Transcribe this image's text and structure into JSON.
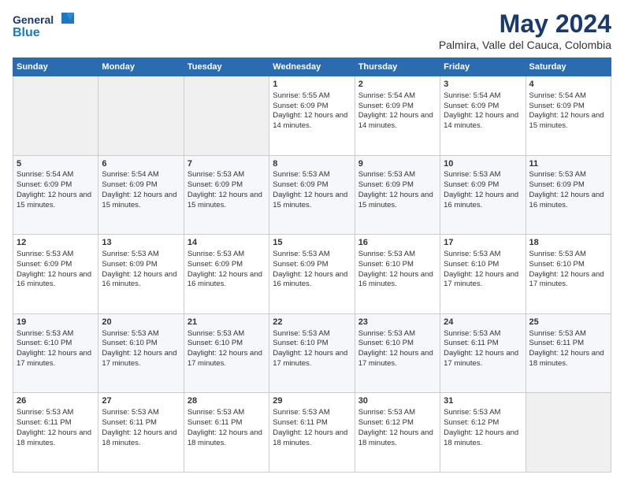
{
  "logo": {
    "general": "General",
    "blue": "Blue"
  },
  "header": {
    "month_year": "May 2024",
    "location": "Palmira, Valle del Cauca, Colombia"
  },
  "weekdays": [
    "Sunday",
    "Monday",
    "Tuesday",
    "Wednesday",
    "Thursday",
    "Friday",
    "Saturday"
  ],
  "weeks": [
    [
      {
        "day": "",
        "sunrise": "",
        "sunset": "",
        "daylight": ""
      },
      {
        "day": "",
        "sunrise": "",
        "sunset": "",
        "daylight": ""
      },
      {
        "day": "",
        "sunrise": "",
        "sunset": "",
        "daylight": ""
      },
      {
        "day": "1",
        "sunrise": "Sunrise: 5:55 AM",
        "sunset": "Sunset: 6:09 PM",
        "daylight": "Daylight: 12 hours and 14 minutes."
      },
      {
        "day": "2",
        "sunrise": "Sunrise: 5:54 AM",
        "sunset": "Sunset: 6:09 PM",
        "daylight": "Daylight: 12 hours and 14 minutes."
      },
      {
        "day": "3",
        "sunrise": "Sunrise: 5:54 AM",
        "sunset": "Sunset: 6:09 PM",
        "daylight": "Daylight: 12 hours and 14 minutes."
      },
      {
        "day": "4",
        "sunrise": "Sunrise: 5:54 AM",
        "sunset": "Sunset: 6:09 PM",
        "daylight": "Daylight: 12 hours and 15 minutes."
      }
    ],
    [
      {
        "day": "5",
        "sunrise": "Sunrise: 5:54 AM",
        "sunset": "Sunset: 6:09 PM",
        "daylight": "Daylight: 12 hours and 15 minutes."
      },
      {
        "day": "6",
        "sunrise": "Sunrise: 5:54 AM",
        "sunset": "Sunset: 6:09 PM",
        "daylight": "Daylight: 12 hours and 15 minutes."
      },
      {
        "day": "7",
        "sunrise": "Sunrise: 5:53 AM",
        "sunset": "Sunset: 6:09 PM",
        "daylight": "Daylight: 12 hours and 15 minutes."
      },
      {
        "day": "8",
        "sunrise": "Sunrise: 5:53 AM",
        "sunset": "Sunset: 6:09 PM",
        "daylight": "Daylight: 12 hours and 15 minutes."
      },
      {
        "day": "9",
        "sunrise": "Sunrise: 5:53 AM",
        "sunset": "Sunset: 6:09 PM",
        "daylight": "Daylight: 12 hours and 15 minutes."
      },
      {
        "day": "10",
        "sunrise": "Sunrise: 5:53 AM",
        "sunset": "Sunset: 6:09 PM",
        "daylight": "Daylight: 12 hours and 16 minutes."
      },
      {
        "day": "11",
        "sunrise": "Sunrise: 5:53 AM",
        "sunset": "Sunset: 6:09 PM",
        "daylight": "Daylight: 12 hours and 16 minutes."
      }
    ],
    [
      {
        "day": "12",
        "sunrise": "Sunrise: 5:53 AM",
        "sunset": "Sunset: 6:09 PM",
        "daylight": "Daylight: 12 hours and 16 minutes."
      },
      {
        "day": "13",
        "sunrise": "Sunrise: 5:53 AM",
        "sunset": "Sunset: 6:09 PM",
        "daylight": "Daylight: 12 hours and 16 minutes."
      },
      {
        "day": "14",
        "sunrise": "Sunrise: 5:53 AM",
        "sunset": "Sunset: 6:09 PM",
        "daylight": "Daylight: 12 hours and 16 minutes."
      },
      {
        "day": "15",
        "sunrise": "Sunrise: 5:53 AM",
        "sunset": "Sunset: 6:09 PM",
        "daylight": "Daylight: 12 hours and 16 minutes."
      },
      {
        "day": "16",
        "sunrise": "Sunrise: 5:53 AM",
        "sunset": "Sunset: 6:10 PM",
        "daylight": "Daylight: 12 hours and 16 minutes."
      },
      {
        "day": "17",
        "sunrise": "Sunrise: 5:53 AM",
        "sunset": "Sunset: 6:10 PM",
        "daylight": "Daylight: 12 hours and 17 minutes."
      },
      {
        "day": "18",
        "sunrise": "Sunrise: 5:53 AM",
        "sunset": "Sunset: 6:10 PM",
        "daylight": "Daylight: 12 hours and 17 minutes."
      }
    ],
    [
      {
        "day": "19",
        "sunrise": "Sunrise: 5:53 AM",
        "sunset": "Sunset: 6:10 PM",
        "daylight": "Daylight: 12 hours and 17 minutes."
      },
      {
        "day": "20",
        "sunrise": "Sunrise: 5:53 AM",
        "sunset": "Sunset: 6:10 PM",
        "daylight": "Daylight: 12 hours and 17 minutes."
      },
      {
        "day": "21",
        "sunrise": "Sunrise: 5:53 AM",
        "sunset": "Sunset: 6:10 PM",
        "daylight": "Daylight: 12 hours and 17 minutes."
      },
      {
        "day": "22",
        "sunrise": "Sunrise: 5:53 AM",
        "sunset": "Sunset: 6:10 PM",
        "daylight": "Daylight: 12 hours and 17 minutes."
      },
      {
        "day": "23",
        "sunrise": "Sunrise: 5:53 AM",
        "sunset": "Sunset: 6:10 PM",
        "daylight": "Daylight: 12 hours and 17 minutes."
      },
      {
        "day": "24",
        "sunrise": "Sunrise: 5:53 AM",
        "sunset": "Sunset: 6:11 PM",
        "daylight": "Daylight: 12 hours and 17 minutes."
      },
      {
        "day": "25",
        "sunrise": "Sunrise: 5:53 AM",
        "sunset": "Sunset: 6:11 PM",
        "daylight": "Daylight: 12 hours and 18 minutes."
      }
    ],
    [
      {
        "day": "26",
        "sunrise": "Sunrise: 5:53 AM",
        "sunset": "Sunset: 6:11 PM",
        "daylight": "Daylight: 12 hours and 18 minutes."
      },
      {
        "day": "27",
        "sunrise": "Sunrise: 5:53 AM",
        "sunset": "Sunset: 6:11 PM",
        "daylight": "Daylight: 12 hours and 18 minutes."
      },
      {
        "day": "28",
        "sunrise": "Sunrise: 5:53 AM",
        "sunset": "Sunset: 6:11 PM",
        "daylight": "Daylight: 12 hours and 18 minutes."
      },
      {
        "day": "29",
        "sunrise": "Sunrise: 5:53 AM",
        "sunset": "Sunset: 6:11 PM",
        "daylight": "Daylight: 12 hours and 18 minutes."
      },
      {
        "day": "30",
        "sunrise": "Sunrise: 5:53 AM",
        "sunset": "Sunset: 6:12 PM",
        "daylight": "Daylight: 12 hours and 18 minutes."
      },
      {
        "day": "31",
        "sunrise": "Sunrise: 5:53 AM",
        "sunset": "Sunset: 6:12 PM",
        "daylight": "Daylight: 12 hours and 18 minutes."
      },
      {
        "day": "",
        "sunrise": "",
        "sunset": "",
        "daylight": ""
      }
    ]
  ]
}
